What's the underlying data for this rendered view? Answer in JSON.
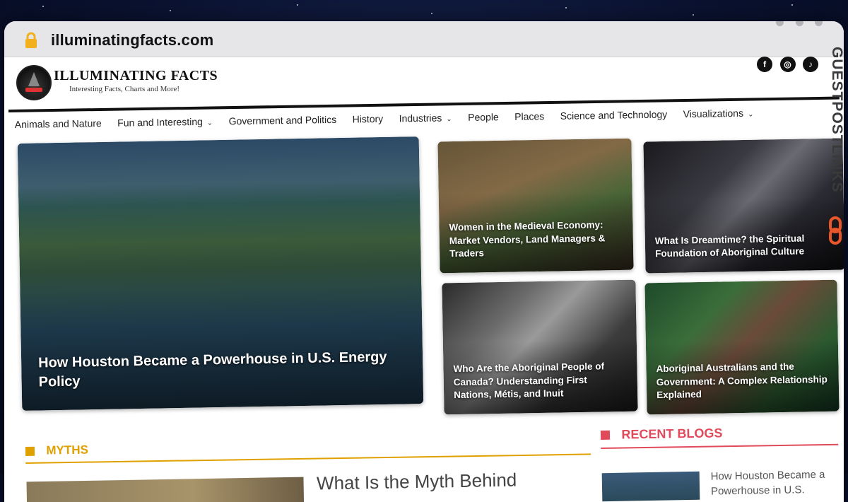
{
  "browser": {
    "url": "illuminatingfacts.com"
  },
  "site": {
    "title": "ILLUMINATING FACTS",
    "tagline": "Interesting Facts, Charts and More!",
    "social": [
      "f",
      "◎",
      "♪"
    ]
  },
  "nav": {
    "items": [
      {
        "label": "Animals and Nature",
        "dropdown": false
      },
      {
        "label": "Fun and Interesting",
        "dropdown": true
      },
      {
        "label": "Government and Politics",
        "dropdown": false
      },
      {
        "label": "History",
        "dropdown": false
      },
      {
        "label": "Industries",
        "dropdown": true
      },
      {
        "label": "People",
        "dropdown": false
      },
      {
        "label": "Places",
        "dropdown": false
      },
      {
        "label": "Science and Technology",
        "dropdown": false
      },
      {
        "label": "Visualizations",
        "dropdown": true
      }
    ]
  },
  "featured": {
    "main": "How Houston Became a Powerhouse in U.S. Energy Policy",
    "tiles": [
      "Women in the Medieval Economy: Market Vendors, Land Managers & Traders",
      "What Is Dreamtime? the Spiritual Foundation of Aboriginal Culture",
      "Who Are the Aboriginal People of Canada? Understanding First Nations, Métis, and Inuit",
      "Aboriginal Australians and the Government: A Complex Relationship Explained"
    ]
  },
  "sections": {
    "myths": {
      "title": "MYTHS",
      "color": "#e0a000",
      "first_heading": "What Is the Myth Behind"
    },
    "recent": {
      "title": "RECENT BLOGS",
      "color": "#e04a5a",
      "first_item": "How Houston Became a Powerhouse in U.S. Energy"
    }
  },
  "watermark": {
    "text": "GUESTPOSTLINKS",
    "accent": "#e8562a"
  }
}
